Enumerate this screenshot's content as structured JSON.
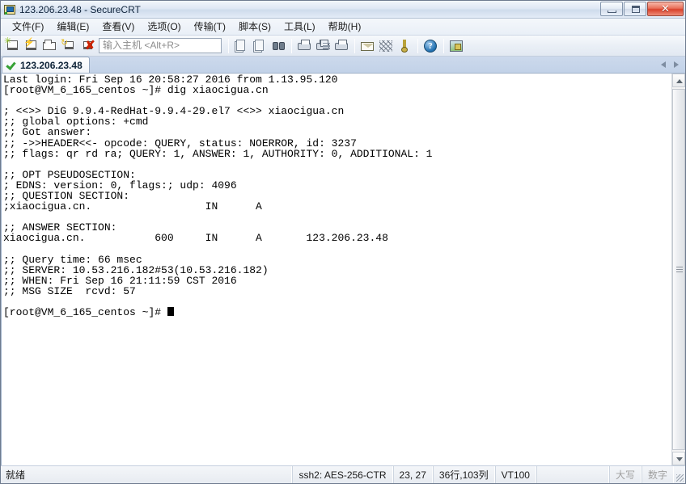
{
  "window": {
    "title": "123.206.23.48 - SecureCRT",
    "app_icon": "securecrt-icon",
    "controls": {
      "minimize": "minimize-button",
      "maximize": "maximize-button",
      "close_glyph": "✕"
    }
  },
  "menubar": {
    "items": [
      {
        "label": "文件(F)"
      },
      {
        "label": "编辑(E)"
      },
      {
        "label": "查看(V)"
      },
      {
        "label": "选项(O)"
      },
      {
        "label": "传输(T)"
      },
      {
        "label": "脚本(S)"
      },
      {
        "label": "工具(L)"
      },
      {
        "label": "帮助(H)"
      }
    ]
  },
  "toolbar": {
    "host_input": {
      "value": "",
      "placeholder": "输入主机 <Alt+R>"
    },
    "buttons": [
      {
        "name": "new-session-icon",
        "tip": "新建会话"
      },
      {
        "name": "quick-connect-icon",
        "tip": "快速连接"
      },
      {
        "name": "session-manager-icon",
        "tip": "会话管理器"
      },
      {
        "name": "reconnect-icon",
        "tip": "重新连接"
      },
      {
        "name": "disconnect-icon",
        "tip": "断开连接"
      },
      {
        "name": "copy-icon",
        "tip": "复制"
      },
      {
        "name": "paste-icon",
        "tip": "粘贴"
      },
      {
        "name": "find-icon",
        "tip": "查找"
      },
      {
        "name": "log-session-icon",
        "tip": "记录会话"
      },
      {
        "name": "print-screen-icon",
        "tip": "打印屏幕"
      },
      {
        "name": "print-icon",
        "tip": "打印"
      },
      {
        "name": "send-mail-icon",
        "tip": "发送邮件"
      },
      {
        "name": "key-exchange-icon",
        "tip": "密钥交换"
      },
      {
        "name": "key-icon",
        "tip": "密钥"
      },
      {
        "name": "help-icon",
        "tip": "帮助"
      },
      {
        "name": "session-options-icon",
        "tip": "会话选项"
      }
    ]
  },
  "tabbar": {
    "tabs": [
      {
        "label": "123.206.23.48",
        "connected": true
      }
    ],
    "nav_left": "scroll-tabs-left",
    "nav_right": "scroll-tabs-right"
  },
  "terminal": {
    "lines": [
      "Last login: Fri Sep 16 20:58:27 2016 from 1.13.95.120",
      "[root@VM_6_165_centos ~]# dig xiaocigua.cn",
      "",
      "; <<>> DiG 9.9.4-RedHat-9.9.4-29.el7 <<>> xiaocigua.cn",
      ";; global options: +cmd",
      ";; Got answer:",
      ";; ->>HEADER<<- opcode: QUERY, status: NOERROR, id: 3237",
      ";; flags: qr rd ra; QUERY: 1, ANSWER: 1, AUTHORITY: 0, ADDITIONAL: 1",
      "",
      ";; OPT PSEUDOSECTION:",
      "; EDNS: version: 0, flags:; udp: 4096",
      ";; QUESTION SECTION:",
      ";xiaocigua.cn.                  IN      A",
      "",
      ";; ANSWER SECTION:",
      "xiaocigua.cn.           600     IN      A       123.206.23.48",
      "",
      ";; Query time: 66 msec",
      ";; SERVER: 10.53.216.182#53(10.53.216.182)",
      ";; WHEN: Fri Sep 16 21:11:59 CST 2016",
      ";; MSG SIZE  rcvd: 57",
      ""
    ],
    "prompt": "[root@VM_6_165_centos ~]# ",
    "cursor": "block-cursor",
    "background": "#ffffff",
    "foreground": "#000000"
  },
  "scrollbar": {
    "up_arrow": "scroll-up-arrow",
    "down_arrow": "scroll-down-arrow",
    "thumb": "scroll-thumb"
  },
  "statusbar": {
    "ready": "就绪",
    "cipher": "ssh2: AES-256-CTR",
    "cursor_pos": "23, 27",
    "dimensions": "36行,103列",
    "emulation": "VT100",
    "caps": "大写",
    "num": "数字"
  }
}
